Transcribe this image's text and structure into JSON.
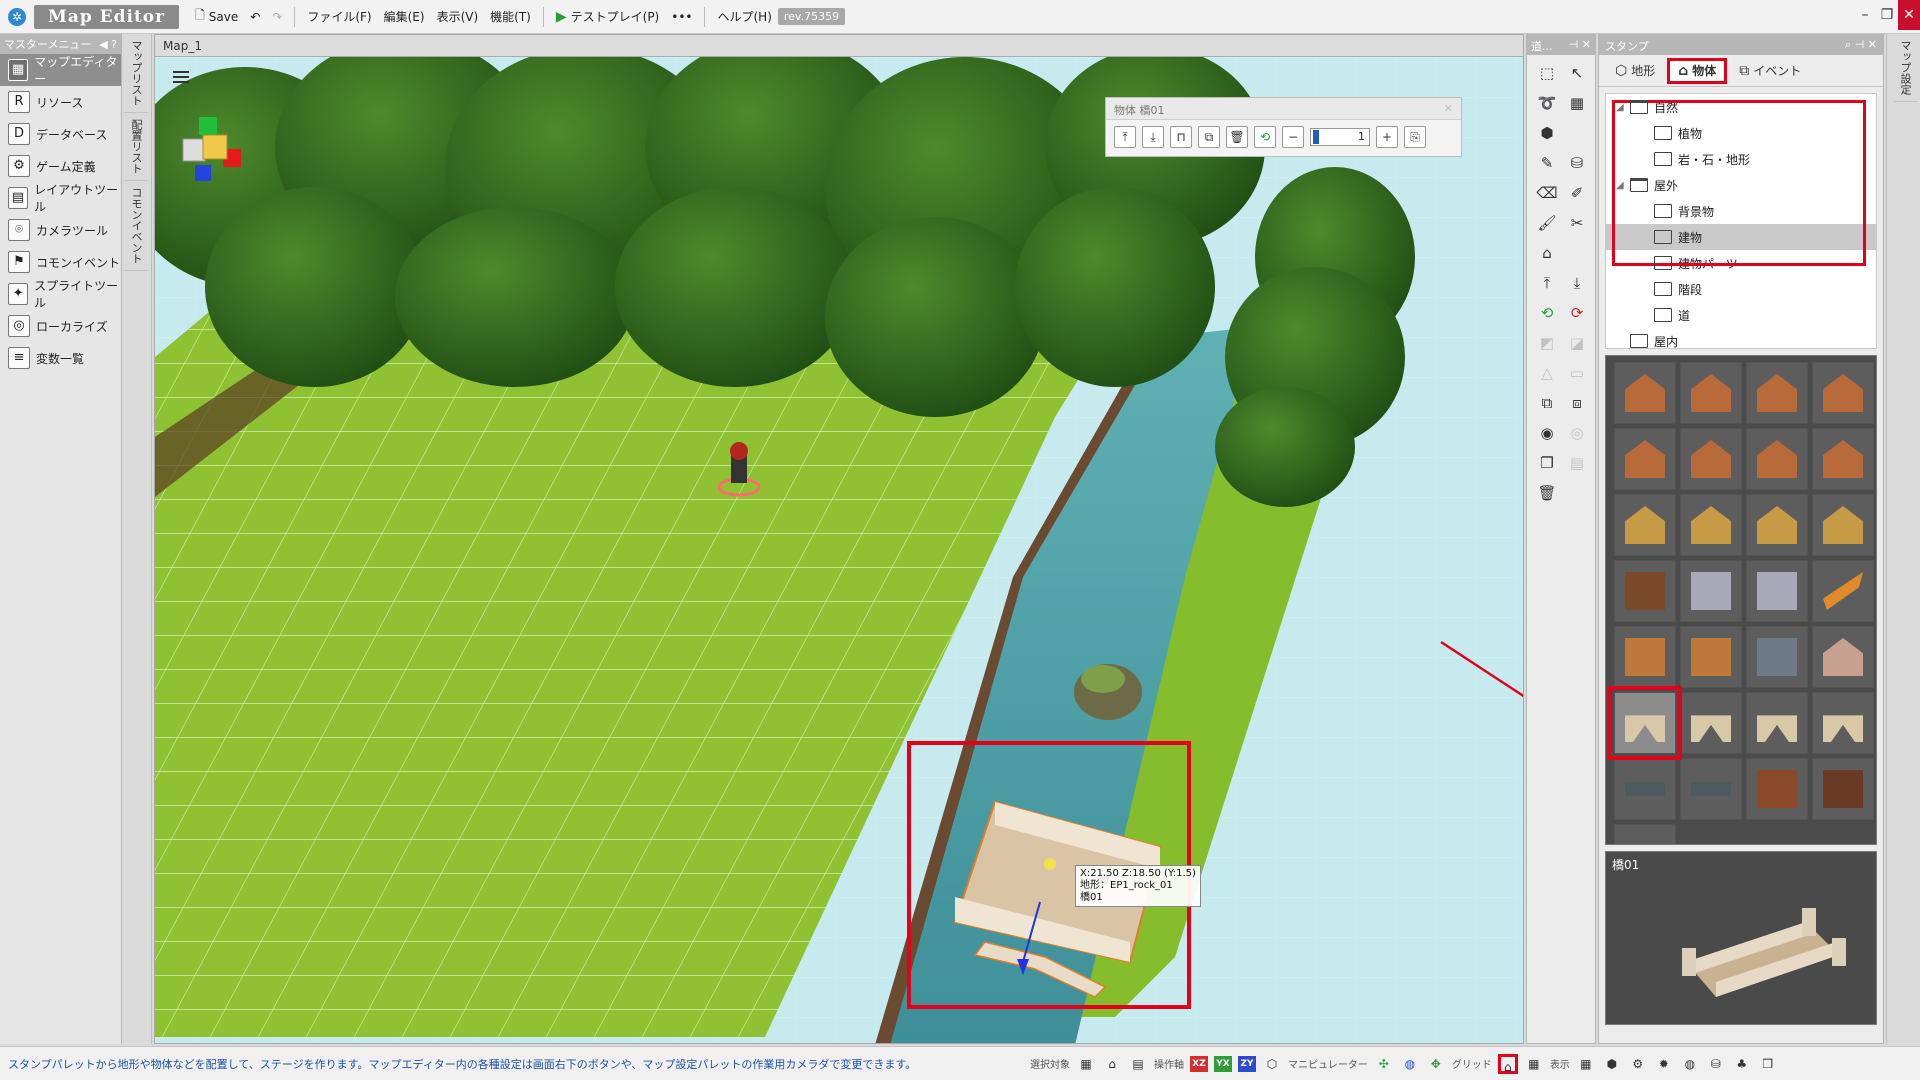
{
  "window": {
    "app_title": "Map Editor",
    "save_label": "Save",
    "menu": [
      "ファイル(F)",
      "編集(E)",
      "表示(V)",
      "機能(T)"
    ],
    "testplay_label": "テストプレイ(P)",
    "more_label": "•••",
    "help_label": "ヘルプ(H)",
    "revision": "rev.75359"
  },
  "master_menu": {
    "header": "マスターメニュー",
    "items": [
      {
        "label": "マップエディター",
        "icon": "map-editor-icon",
        "active": true
      },
      {
        "label": "リソース",
        "icon": "resource-icon"
      },
      {
        "label": "データベース",
        "icon": "database-icon"
      },
      {
        "label": "ゲーム定義",
        "icon": "game-definition-icon"
      },
      {
        "label": "レイアウトツール",
        "icon": "layout-tool-icon"
      },
      {
        "label": "カメラツール",
        "icon": "camera-tool-icon"
      },
      {
        "label": "コモンイベント",
        "icon": "common-event-icon"
      },
      {
        "label": "スプライトツール",
        "icon": "sprite-tool-icon"
      },
      {
        "label": "ローカライズ",
        "icon": "localize-icon"
      },
      {
        "label": "変数一覧",
        "icon": "variable-list-icon"
      }
    ]
  },
  "side_tabs": [
    "マップリスト",
    "配置リスト",
    "コモンイベント"
  ],
  "right_side_tab": "マップ設定",
  "map": {
    "tab_label": "Map_1",
    "object_toolbar_title": "物体 橋01",
    "slider_value": "1",
    "tooltip": {
      "coords": "X:21.50 Z:18.50 (Y:1.5)",
      "terrain": "地形：EP1_rock_01",
      "object": "橋01"
    }
  },
  "tool_panel": {
    "header": "道..."
  },
  "stamp": {
    "header": "スタンプ",
    "tabs": [
      {
        "label": "地形",
        "icon": "terrain-icon"
      },
      {
        "label": "物体",
        "icon": "object-icon",
        "active": true
      },
      {
        "label": "イベント",
        "icon": "event-icon"
      }
    ],
    "tree": [
      {
        "label": "自然",
        "depth": 0,
        "open": true
      },
      {
        "label": "植物",
        "depth": 1
      },
      {
        "label": "岩・石・地形",
        "depth": 1
      },
      {
        "label": "屋外",
        "depth": 0,
        "open": true
      },
      {
        "label": "背景物",
        "depth": 1
      },
      {
        "label": "建物",
        "depth": 1,
        "selected": true
      },
      {
        "label": "建物パーツ",
        "depth": 1
      },
      {
        "label": "階段",
        "depth": 1
      },
      {
        "label": "道",
        "depth": 1
      },
      {
        "label": "屋内",
        "depth": 0
      }
    ],
    "palette": [
      "house-red-roof",
      "house-red-roof-2",
      "house-red-roof-3",
      "house-timber",
      "house-dark",
      "house-dark-2",
      "house-dark-3",
      "house-dark-4",
      "hut-straw",
      "hut-straw-2",
      "hut-straw-3",
      "hut-straw-4",
      "gate-wood",
      "castle",
      "castle-2",
      "banner-orange",
      "windmill",
      "windmill-2",
      "tower-stone",
      "chapel",
      "bridge-stone",
      "bridge-arch",
      "bridge-wood",
      "bridge-wood-2",
      "plank-dark",
      "plank-dark-2",
      "table-wood",
      "tunnel-mine",
      "plank-dark-3"
    ],
    "selected_index": 20,
    "preview_label": "橋01"
  },
  "status": {
    "message": "スタンプパレットから地形や物体などを配置して、ステージを作ります。マップエディター内の各種設定は画面右下のボタンや、マップ設定パレットの作業用カメラダで変更できます。",
    "select_target_label": "選択対象",
    "axis_label": "操作軸",
    "axes": [
      "XZ",
      "YX",
      "ZY"
    ],
    "manipulator_label": "マニピュレーター",
    "grid_label": "グリッド",
    "display_label": "表示"
  }
}
